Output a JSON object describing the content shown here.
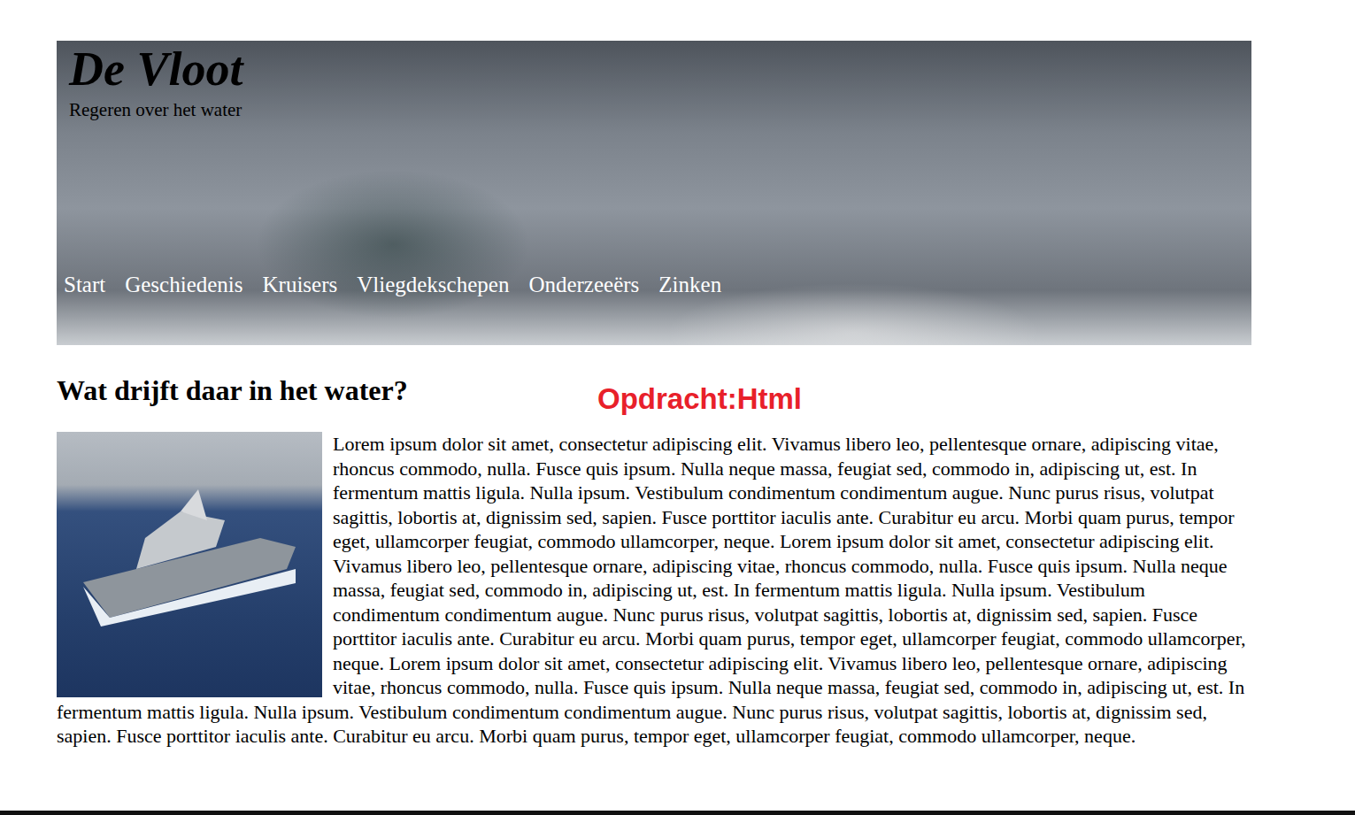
{
  "header": {
    "title": "De Vloot",
    "subtitle": "Regeren over het water"
  },
  "nav": [
    {
      "label": "Start"
    },
    {
      "label": "Geschiedenis"
    },
    {
      "label": "Kruisers"
    },
    {
      "label": "Vliegdekschepen"
    },
    {
      "label": "Onderzeeërs"
    },
    {
      "label": "Zinken"
    }
  ],
  "article": {
    "heading": "Wat drijft daar in het water?",
    "text": "Lorem ipsum dolor sit amet, consectetur adipiscing elit. Vivamus libero leo, pellentesque ornare, adipiscing vitae, rhoncus commodo, nulla. Fusce quis ipsum. Nulla neque massa, feugiat sed, commodo in, adipiscing ut, est. In fermentum mattis ligula. Nulla ipsum. Vestibulum condimentum condimentum augue. Nunc purus risus, volutpat sagittis, lobortis at, dignissim sed, sapien. Fusce porttitor iaculis ante. Curabitur eu arcu. Morbi quam purus, tempor eget, ullamcorper feugiat, commodo ullamcorper, neque. Lorem ipsum dolor sit amet, consectetur adipiscing elit. Vivamus libero leo, pellentesque ornare, adipiscing vitae, rhoncus commodo, nulla. Fusce quis ipsum. Nulla neque massa, feugiat sed, commodo in, adipiscing ut, est. In fermentum mattis ligula. Nulla ipsum. Vestibulum condimentum condimentum augue. Nunc purus risus, volutpat sagittis, lobortis at, dignissim sed, sapien. Fusce porttitor iaculis ante. Curabitur eu arcu. Morbi quam purus, tempor eget, ullamcorper feugiat, commodo ullamcorper, neque. Lorem ipsum dolor sit amet, consectetur adipiscing elit. Vivamus libero leo, pellentesque ornare, adipiscing vitae, rhoncus commodo, nulla. Fusce quis ipsum. Nulla neque massa, feugiat sed, commodo in, adipiscing ut, est. In fermentum mattis ligula. Nulla ipsum. Vestibulum condimentum condimentum augue. Nunc purus risus, volutpat sagittis, lobortis at, dignissim sed, sapien. Fusce porttitor iaculis ante. Curabitur eu arcu. Morbi quam purus, tempor eget, ullamcorper feugiat, commodo ullamcorper, neque."
  },
  "annotation": "Opdracht:Html"
}
